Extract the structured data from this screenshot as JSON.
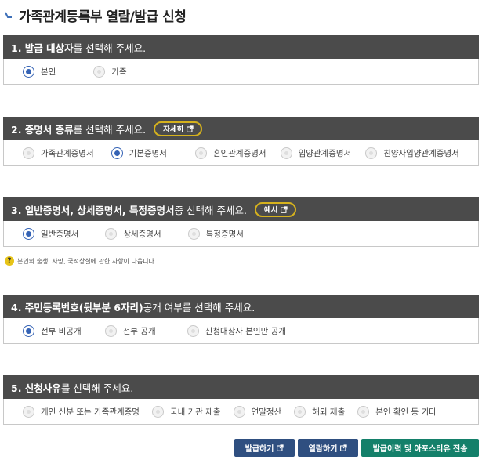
{
  "page_title": "가족관계등록부 열람/발급 신청",
  "sections": [
    {
      "title_bold": "1. 발급 대상자",
      "title_rest": "를 선택해 주세요.",
      "options": [
        {
          "label": "본인",
          "selected": true
        },
        {
          "label": "가족",
          "selected": false
        }
      ]
    },
    {
      "title_bold": "2. 증명서 종류",
      "title_rest": "를 선택해 주세요.",
      "pill": "자세히",
      "options": [
        {
          "label": "가족관계증명서",
          "selected": false
        },
        {
          "label": "기본증명서",
          "selected": true
        },
        {
          "label": "혼인관계증명서",
          "selected": false
        },
        {
          "label": "입양관계증명서",
          "selected": false
        },
        {
          "label": "친양자입양관계증명서",
          "selected": false
        }
      ]
    },
    {
      "title_bold": "3. 일반증명서, 상세증명서, 특정증명서",
      "title_rest": " 중 선택해 주세요.",
      "pill": "예시",
      "options": [
        {
          "label": "일반증명서",
          "selected": true
        },
        {
          "label": "상세증명서",
          "selected": false
        },
        {
          "label": "특정증명서",
          "selected": false
        }
      ]
    },
    {
      "title_bold": "4. 주민등록번호(뒷부분 6자리)",
      "title_rest": " 공개 여부를 선택해 주세요.",
      "options": [
        {
          "label": "전부 비공개",
          "selected": true
        },
        {
          "label": "전부 공개",
          "selected": false
        },
        {
          "label": "신청대상자 본인만 공개",
          "selected": false
        }
      ]
    },
    {
      "title_bold": "5. 신청사유",
      "title_rest": "를 선택해 주세요.",
      "options": [
        {
          "label": "개인 신분 또는 가족관계증명",
          "selected": false
        },
        {
          "label": "국내 기관 제출",
          "selected": false
        },
        {
          "label": "연말정산",
          "selected": false
        },
        {
          "label": "해외 제출",
          "selected": false
        },
        {
          "label": "본인 확인 등 기타",
          "selected": false
        }
      ]
    }
  ],
  "note": {
    "icon": "question-icon",
    "text": "본인의 출생, 사망, 국적상실에 관한 사항이 나옵니다."
  },
  "buttons": {
    "issue": "발급하기",
    "view": "열람하기",
    "history": "발급이력 및 아포스티유 전송"
  },
  "colors": {
    "header_bg": "#4b4b4b",
    "radio_selected": "#3563b5",
    "pill_border": "#d6b21d",
    "btn_navy": "#2f4f80",
    "btn_green": "#14806a",
    "note_icon": "#e7c418"
  }
}
